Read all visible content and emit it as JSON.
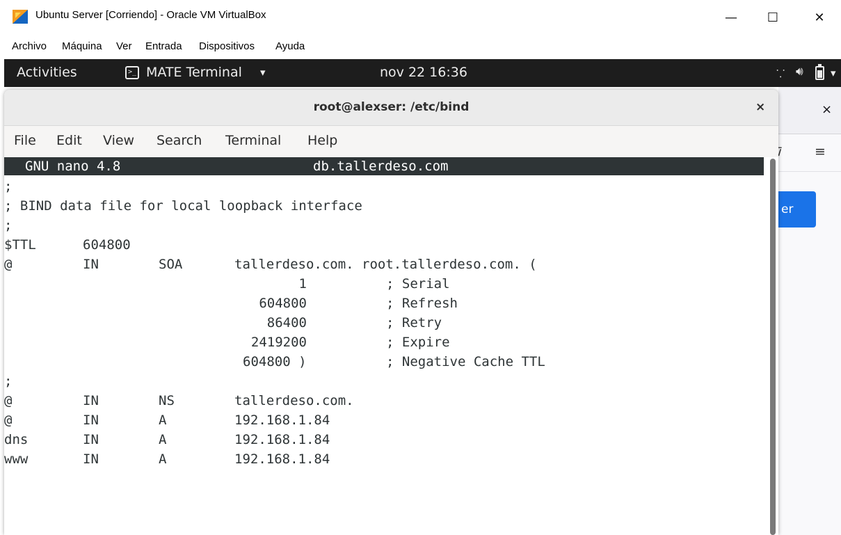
{
  "vbox": {
    "title": "Ubuntu Server [Corriendo] - Oracle VM VirtualBox",
    "menu": [
      "Archivo",
      "Máquina",
      "Ver",
      "Entrada",
      "Dispositivos",
      "Ayuda"
    ],
    "minimize": "—",
    "maximize": "☐",
    "close": "✕"
  },
  "gnome_topbar": {
    "activities": "Activities",
    "app_name": "MATE Terminal",
    "app_caret": "▾",
    "clock": "nov 22 16:36",
    "network_icon": "network-icon",
    "network_glyph": "⸪",
    "volume_glyph": "🔊︎",
    "tray_caret": "▾"
  },
  "background_window": {
    "close": "×",
    "pocket_glyph": "⊽",
    "menu_glyph": "≡",
    "button_fragment": "er"
  },
  "terminal": {
    "title": "root@alexser: /etc/bind",
    "close": "×",
    "menu": [
      "File",
      "Edit",
      "View",
      "Search",
      "Terminal",
      "Help"
    ],
    "nano_version": "GNU nano 4.8",
    "nano_filename": "db.tallerdeso.com",
    "lines": [
      {
        "c1": ";"
      },
      {
        "c1": "; BIND data file for local loopback interface"
      },
      {
        "c1": ";"
      },
      {
        "c1": "$TTL",
        "c2": "604800"
      },
      {
        "c1": "@",
        "c2": "IN",
        "c3": "SOA",
        "c4": "tallerdeso.com. root.tallerdeso.com. ("
      },
      {
        "num": "1",
        "comment": "; Serial"
      },
      {
        "num": "604800",
        "comment": "; Refresh"
      },
      {
        "num": "86400",
        "comment": "; Retry"
      },
      {
        "num": "2419200",
        "comment": "; Expire"
      },
      {
        "num": "604800 )",
        "comment": "; Negative Cache TTL"
      },
      {
        "c1": ";"
      },
      {
        "c1": "@",
        "c2": "IN",
        "c3": "NS",
        "c4": "tallerdeso.com."
      },
      {
        "c1": "@",
        "c2": "IN",
        "c3": "A",
        "c4": "192.168.1.84"
      },
      {
        "c1": "dns",
        "c2": "IN",
        "c3": "A",
        "c4": "192.168.1.84"
      },
      {
        "c1": "www",
        "c2": "IN",
        "c3": "A",
        "c4": "192.168.1.84"
      }
    ]
  },
  "colors": {
    "gnome_topbar": "#1d1d1d",
    "nano_header": "#2e3436",
    "accent_blue": "#1a73e8"
  }
}
